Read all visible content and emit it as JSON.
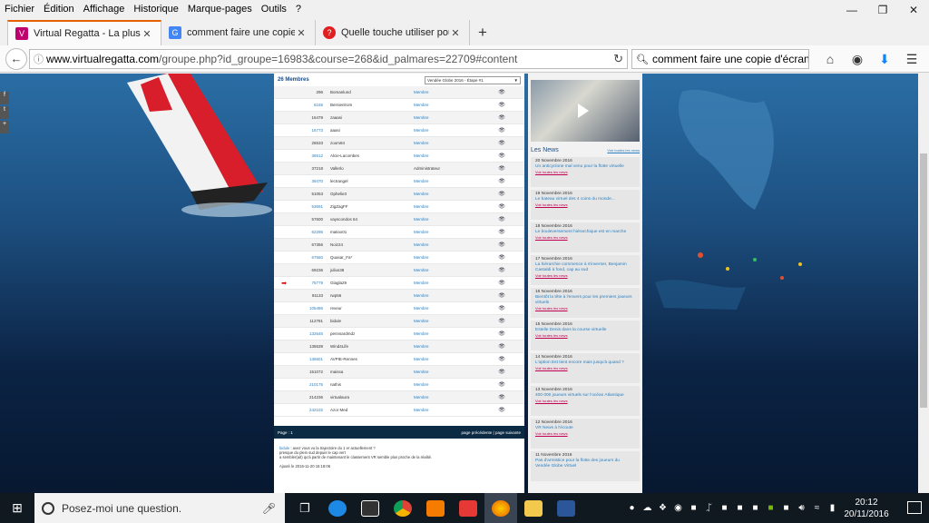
{
  "menu": [
    "Fichier",
    "Édition",
    "Affichage",
    "Historique",
    "Marque-pages",
    "Outils",
    "?"
  ],
  "tabs": [
    {
      "title": "Virtual Regatta - La plus g...",
      "favicon_color": "#c0006e",
      "active": true
    },
    {
      "title": "comment faire une copie ...",
      "favicon_color": "#4285f4",
      "active": false
    },
    {
      "title": "Quelle touche utiliser pour...",
      "favicon_color": "#e02020",
      "active": false
    }
  ],
  "url": {
    "host": "www.virtualregatta.com",
    "path": "/groupe.php?id_groupe=16983&course=268&id_palmares=22709#content"
  },
  "search": {
    "value": "comment faire une copie d'écran"
  },
  "members": {
    "title": "26 Membres",
    "race_select": "Vendée Globe 2016 - Étape #1",
    "rows": [
      {
        "rank": "296",
        "nick": "Bomanlund",
        "role": "Membre",
        "link": false,
        "arrow": false
      },
      {
        "rank": "6165",
        "nick": "Bernienlrom",
        "role": "Membre",
        "link": true,
        "arrow": false
      },
      {
        "rank": "16479",
        "nick": "zaaasi",
        "role": "Membre",
        "link": false,
        "arrow": false
      },
      {
        "rank": "16773",
        "nick": "aaasi",
        "role": "Membre",
        "link": true,
        "arrow": false
      },
      {
        "rank": "26533",
        "nick": "zoom84",
        "role": "Membre",
        "link": false,
        "arrow": false
      },
      {
        "rank": "36512",
        "nick": "Alcie-Lacombes",
        "role": "Membre",
        "link": true,
        "arrow": false
      },
      {
        "rank": "37218",
        "nick": "Vallerlo",
        "role": "Administrateur",
        "link": false,
        "arrow": false
      },
      {
        "rank": "39470",
        "nick": "lectrangel",
        "role": "Membre",
        "link": true,
        "arrow": false
      },
      {
        "rank": "51053",
        "nick": "Ophelie3",
        "role": "Membre",
        "link": false,
        "arrow": false
      },
      {
        "rank": "53691",
        "nick": "ZigZagFF",
        "role": "Membre",
        "link": true,
        "arrow": false
      },
      {
        "rank": "57600",
        "nick": "vayscondos 64",
        "role": "Membre",
        "link": false,
        "arrow": false
      },
      {
        "rank": "62295",
        "nick": "matiox01",
        "role": "Membre",
        "link": true,
        "arrow": false
      },
      {
        "rank": "67356",
        "nick": "Noiz24",
        "role": "Membre",
        "link": false,
        "arrow": false
      },
      {
        "rank": "67560",
        "nick": "Quasar_Fa*",
        "role": "Membre",
        "link": true,
        "arrow": false
      },
      {
        "rank": "69236",
        "nick": "julius38",
        "role": "Membre",
        "link": false,
        "arrow": false
      },
      {
        "rank": "75779",
        "nick": "Glagla29",
        "role": "Membre",
        "link": true,
        "arrow": true
      },
      {
        "rank": "91133",
        "nick": "rwp56",
        "role": "Membre",
        "link": false,
        "arrow": false
      },
      {
        "rank": "105486",
        "nick": "reveur",
        "role": "Membre",
        "link": true,
        "arrow": false
      },
      {
        "rank": "112781",
        "nick": "bidule",
        "role": "Membre",
        "link": false,
        "arrow": false
      },
      {
        "rank": "132646",
        "nick": "pennsardmdz",
        "role": "Membre",
        "link": true,
        "arrow": false
      },
      {
        "rank": "135639",
        "nick": "Wind4Life",
        "role": "Membre",
        "link": false,
        "arrow": false
      },
      {
        "rank": "136601",
        "nick": "AVPIE-Rennes",
        "role": "Membre",
        "link": true,
        "arrow": false
      },
      {
        "rank": "151072",
        "nick": "maissa",
        "role": "Membre",
        "link": false,
        "arrow": false
      },
      {
        "rank": "210175",
        "nick": "nathis",
        "role": "Membre",
        "link": true,
        "arrow": false
      },
      {
        "rank": "214236",
        "nick": "virtualaura",
        "role": "Membre",
        "link": false,
        "arrow": false
      },
      {
        "rank": "242102",
        "nick": "Azor Med",
        "role": "Membre",
        "link": true,
        "arrow": false
      }
    ],
    "page_label": "Page : 1",
    "pager_links": "page précédente | page suivante"
  },
  "comment": {
    "author": "bidule",
    "text": " : avez vous vu la trajectoire du 1 er actuellement ?",
    "line2": "presque du plein sud depuis le cap vert",
    "line3": "a sembler(ait) qu'à partir de maintenant le classement VR semble plus proche de la réalité.",
    "date": "Ajouté le 2016-11-20 15:18:06"
  },
  "news": {
    "title": "Les News",
    "all_label": "Voir toutes les news",
    "items": [
      {
        "date": "20 Novembre 2016",
        "headline": "Un anticyclone mal venu pour la flotte virtuelle",
        "link": "Voir toutes les news"
      },
      {
        "date": "19 Novembre 2016",
        "headline": "Le bateau virtuel des 4 coins du monde...",
        "link": "Voir toutes les news"
      },
      {
        "date": "18 Novembre 2016",
        "headline": "Le bouleversement hiérarchique est en marche",
        "link": "Voir toutes les news"
      },
      {
        "date": "17 Novembre 2016",
        "headline": "La hiérarchie commence à s'inverser, Benjamin Castaldi à fond, cap au sud",
        "link": "Voir toutes les news"
      },
      {
        "date": "16 Novembre 2016",
        "headline": "Bientôt la tête à l'envers pour les premiers joueurs virtuels",
        "link": "Voir toutes les news"
      },
      {
        "date": "15 Novembre 2016",
        "headline": "Estelle Denis dans la course virtuelle",
        "link": "Voir toutes les news"
      },
      {
        "date": "14 Novembre 2016",
        "headline": "L'option Est tient encore mais jusqu'à quand ?",
        "link": "Voir toutes les news"
      },
      {
        "date": "13 Novembre 2016",
        "headline": "400 000 joueurs virtuels sur l'océan Atlantique",
        "link": "Voir toutes les news"
      },
      {
        "date": "12 Novembre 2016",
        "headline": "VR News à l'écoute",
        "link": "Voir toutes les news"
      },
      {
        "date": "11 Novembre 2016",
        "headline": "Pas d'armistice pour la flotte des joueurs du Vendée Globe Virtuel",
        "link": ""
      }
    ]
  },
  "taskbar": {
    "search_placeholder": "Posez-moi une question.",
    "time": "20:12",
    "date": "20/11/2016"
  }
}
